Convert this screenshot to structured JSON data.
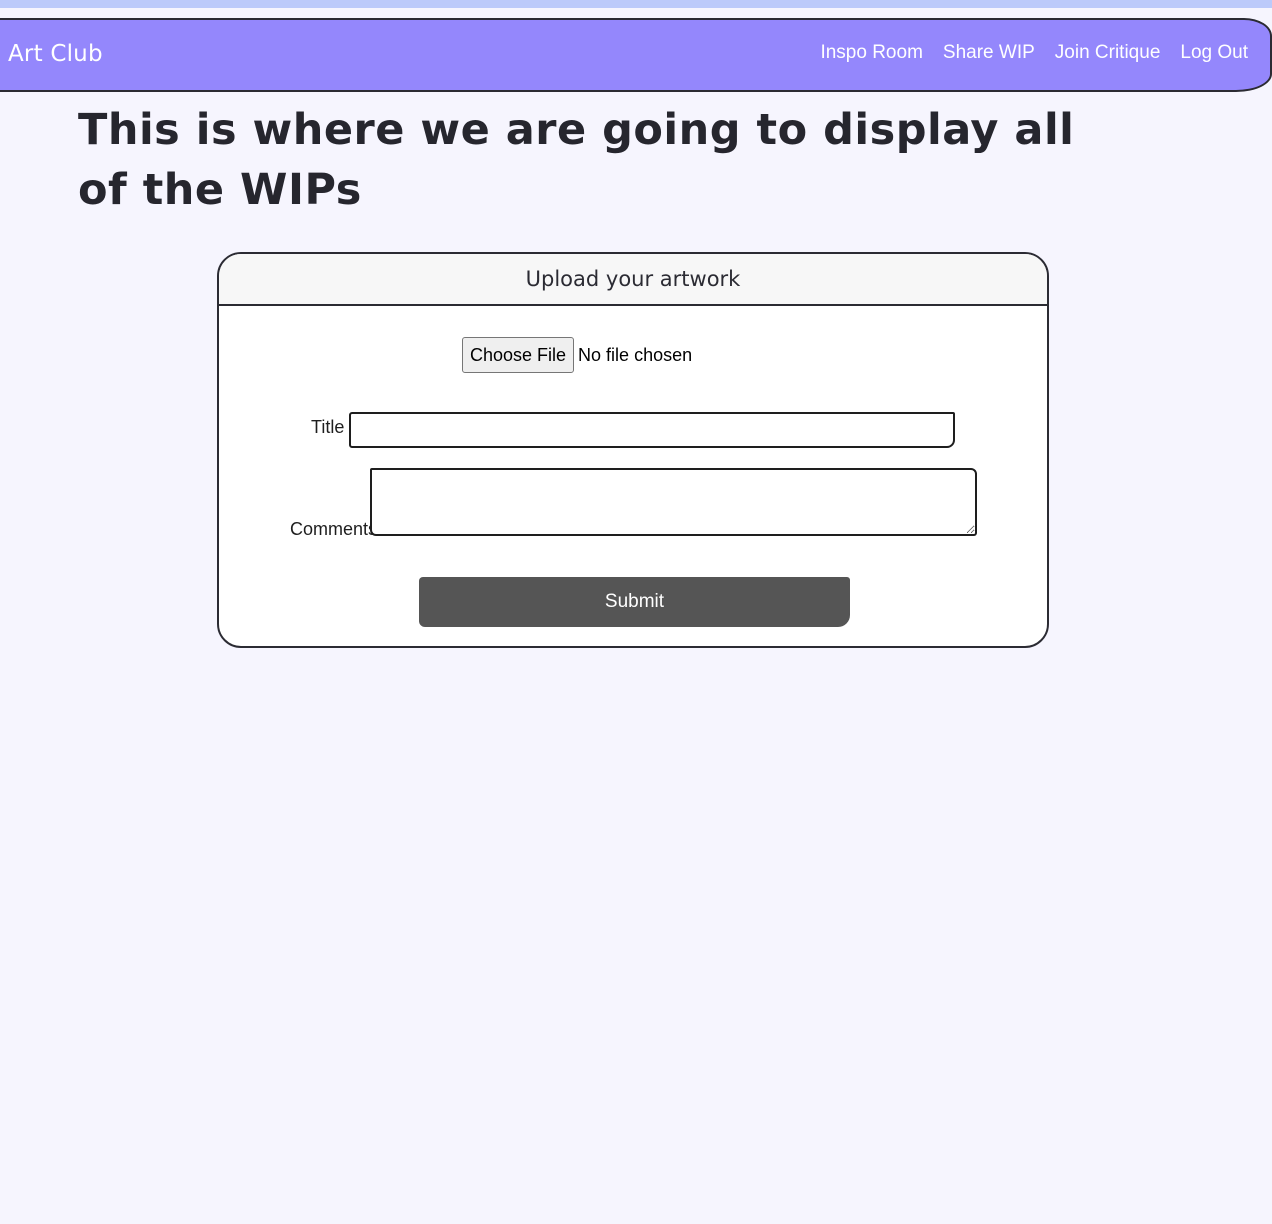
{
  "colors": {
    "navbar_background": "#9487fc",
    "page_background": "#f6f5fe",
    "top_strip": "#bccafa",
    "submit_background": "#555555",
    "card_header_background": "#f7f7f7"
  },
  "navbar": {
    "brand": "Art Club",
    "links": [
      "Inspo Room",
      "Share WIP",
      "Join Critique",
      "Log Out"
    ]
  },
  "main": {
    "title": "This is where we are going to display all of the WIPs"
  },
  "upload_form": {
    "header": "Upload your artwork",
    "file_button_label": "Choose File",
    "file_status": "No file chosen",
    "title_label": "Title",
    "title_value": "",
    "comments_label": "Comments",
    "comments_value": "",
    "submit_label": "Submit"
  }
}
